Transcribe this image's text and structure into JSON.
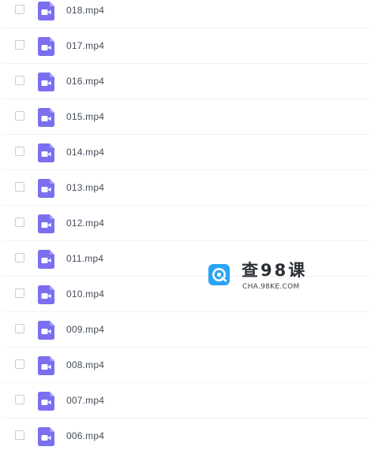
{
  "files": [
    {
      "name": "018.mp4",
      "icon": "video-file-icon"
    },
    {
      "name": "017.mp4",
      "icon": "video-file-icon"
    },
    {
      "name": "016.mp4",
      "icon": "video-file-icon"
    },
    {
      "name": "015.mp4",
      "icon": "video-file-icon"
    },
    {
      "name": "014.mp4",
      "icon": "video-file-icon"
    },
    {
      "name": "013.mp4",
      "icon": "video-file-icon"
    },
    {
      "name": "012.mp4",
      "icon": "video-file-icon"
    },
    {
      "name": "011.mp4",
      "icon": "video-file-icon"
    },
    {
      "name": "010.mp4",
      "icon": "video-file-icon"
    },
    {
      "name": "009.mp4",
      "icon": "video-file-icon"
    },
    {
      "name": "008.mp4",
      "icon": "video-file-icon"
    },
    {
      "name": "007.mp4",
      "icon": "video-file-icon"
    },
    {
      "name": "006.mp4",
      "icon": "video-file-icon"
    }
  ],
  "watermark": {
    "title": "查98课",
    "url": "CHA.98KE.COM",
    "logo_icon": "cha98ke-logo-icon"
  },
  "colors": {
    "file_icon": "#7b6ff0",
    "logo": "#2aa4f4",
    "divider": "#f1f2f4",
    "text": "#454d5a"
  }
}
